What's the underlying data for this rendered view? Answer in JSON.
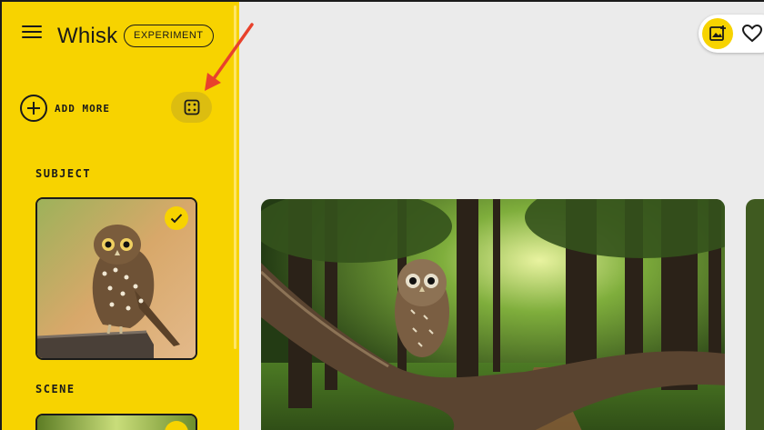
{
  "header": {
    "title": "Whisk",
    "badge": "EXPERIMENT"
  },
  "sidebar": {
    "add_more_label": "ADD MORE",
    "subject_label": "SUBJECT",
    "scene_label": "SCENE"
  },
  "icons": {
    "menu": "menu-icon",
    "add": "plus-circle-icon",
    "dice": "dice-icon",
    "check": "check-icon",
    "add_image": "image-add-icon",
    "favorite": "heart-icon"
  },
  "colors": {
    "accent_yellow": "#f7d300",
    "canvas_bg": "#ebebeb",
    "annotation_red": "#e8412c"
  }
}
